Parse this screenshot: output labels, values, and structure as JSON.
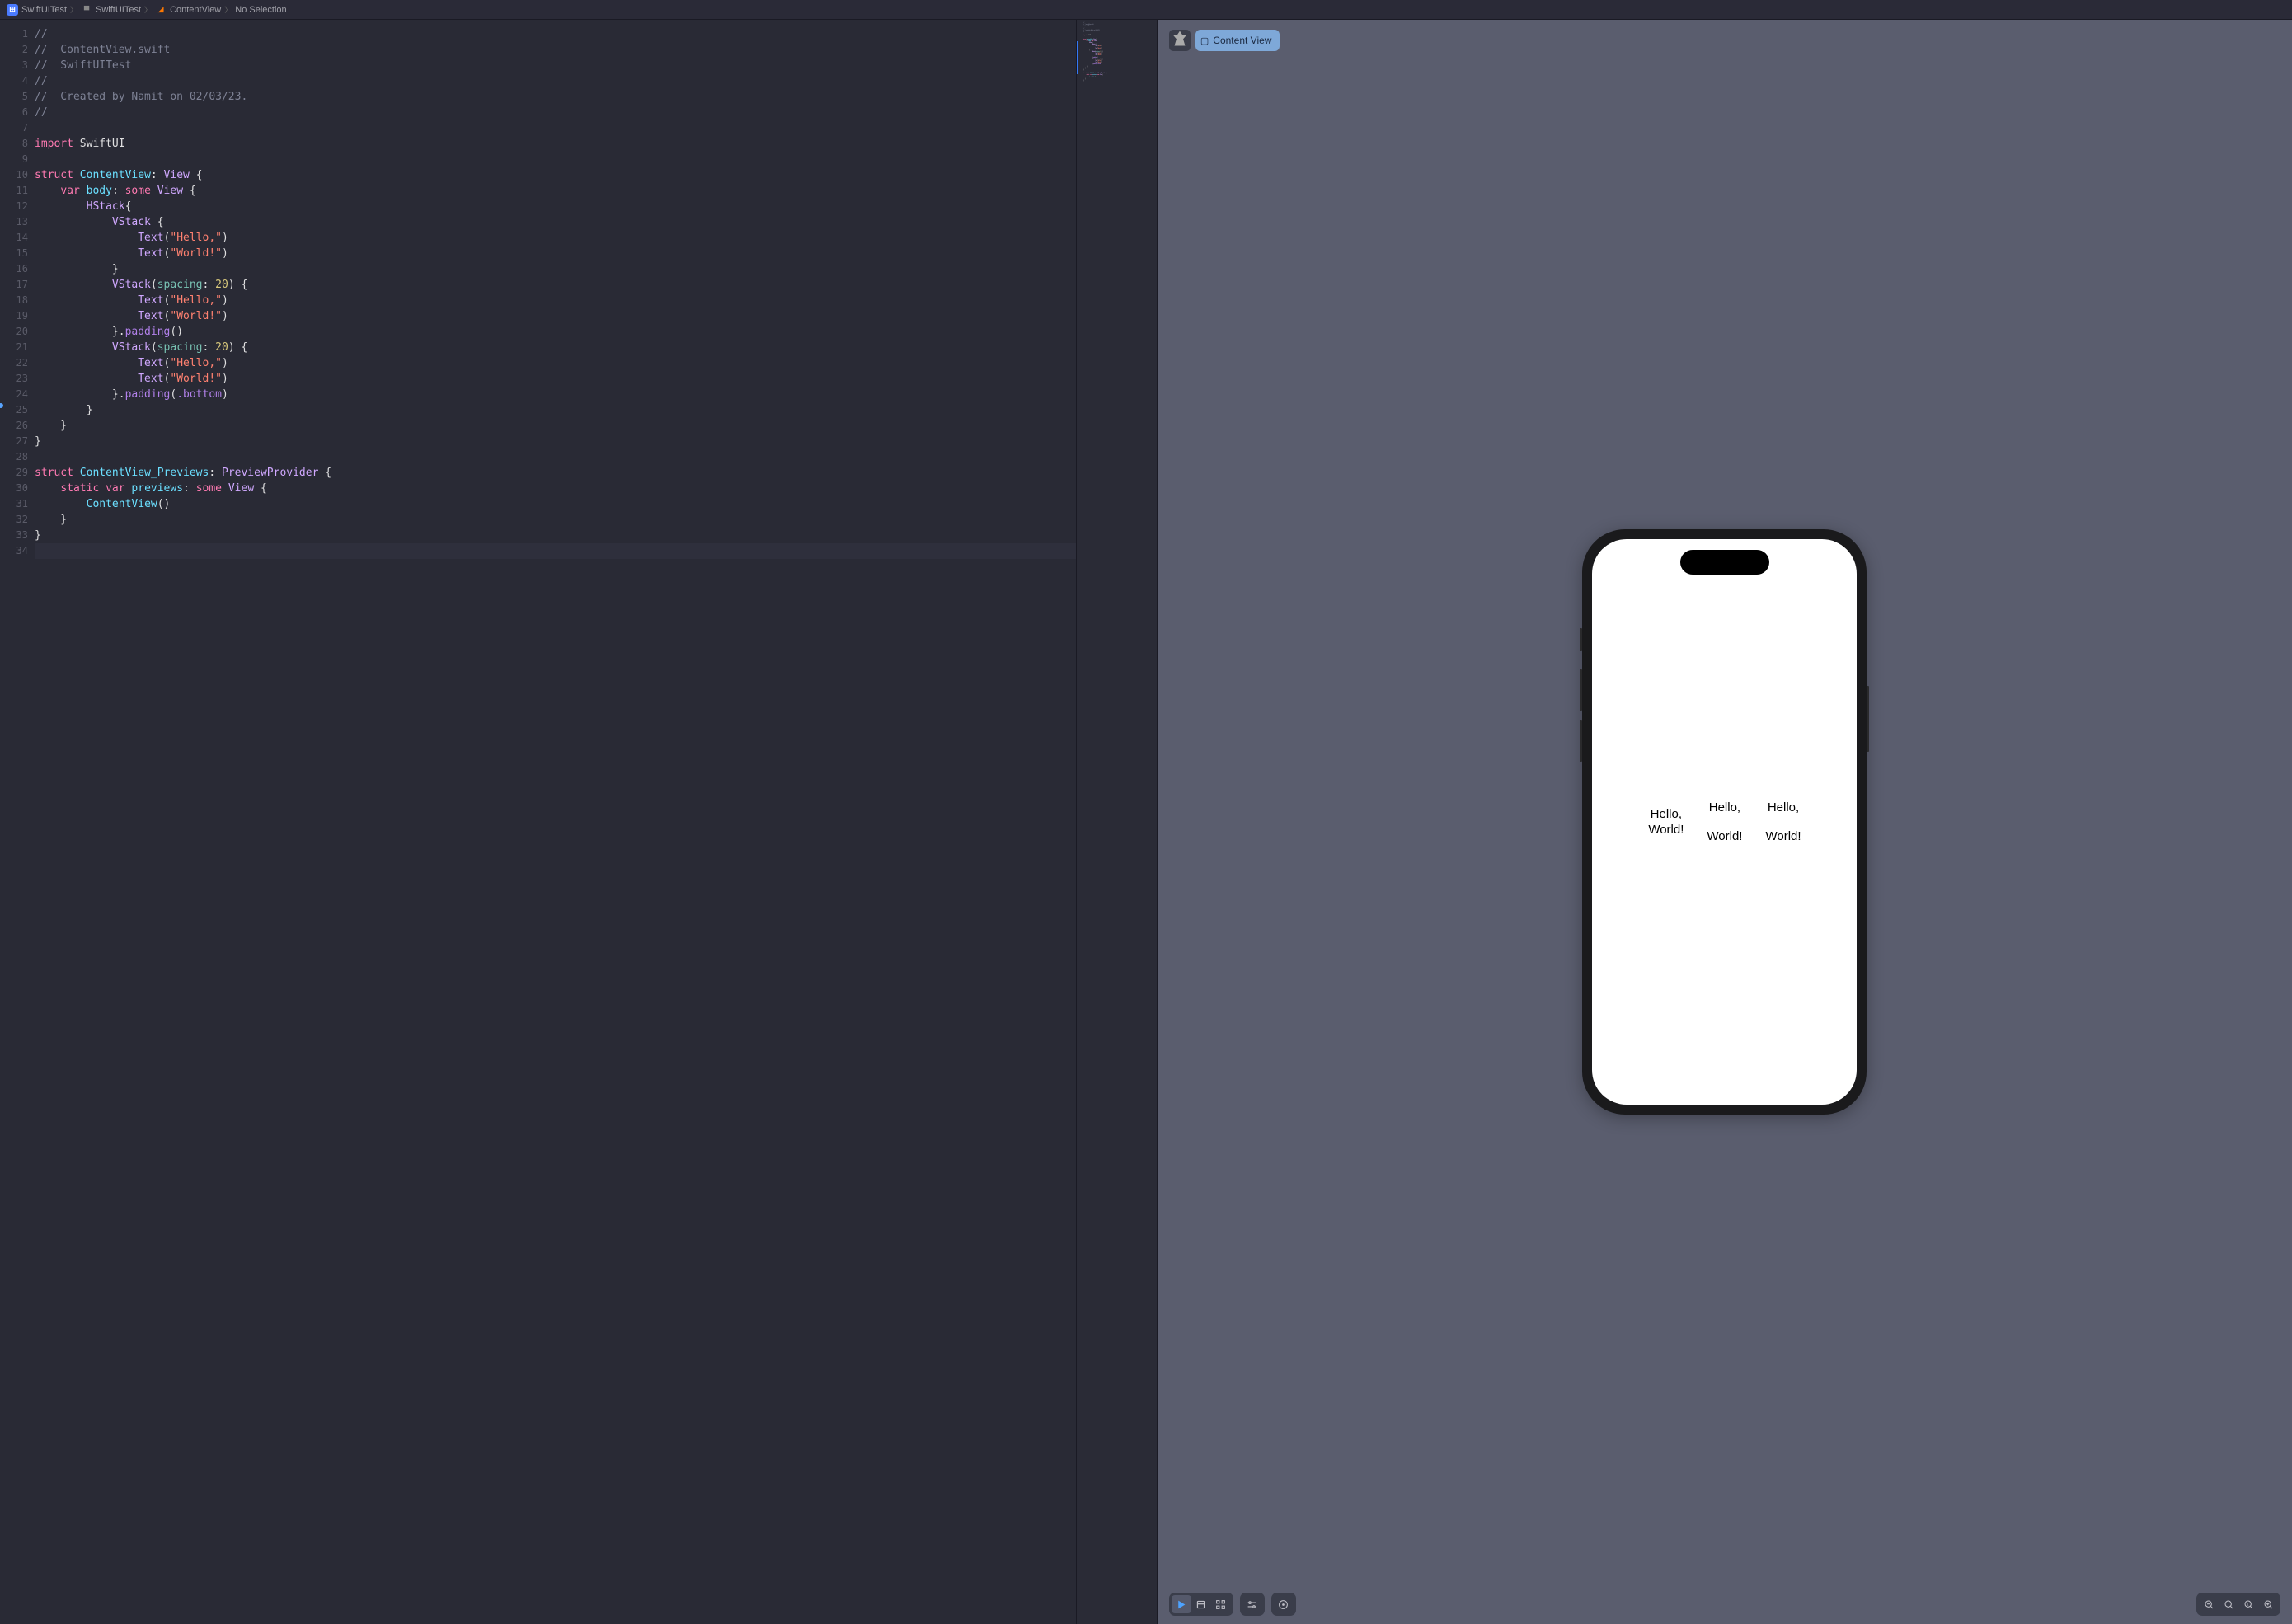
{
  "breadcrumb": {
    "project": "SwiftUITest",
    "folder": "SwiftUITest",
    "file": "ContentView",
    "selection": "No Selection"
  },
  "code": {
    "lines": [
      {
        "n": 1,
        "t": "comment",
        "txt": "//"
      },
      {
        "n": 2,
        "t": "comment",
        "txt": "//  ContentView.swift"
      },
      {
        "n": 3,
        "t": "comment",
        "txt": "//  SwiftUITest"
      },
      {
        "n": 4,
        "t": "comment",
        "txt": "//"
      },
      {
        "n": 5,
        "t": "comment",
        "txt": "//  Created by Namit on 02/03/23."
      },
      {
        "n": 6,
        "t": "comment",
        "txt": "//"
      },
      {
        "n": 7,
        "t": "blank",
        "txt": ""
      },
      {
        "n": 8,
        "t": "import",
        "kw": "import",
        "mod": "SwiftUI"
      },
      {
        "n": 9,
        "t": "blank",
        "txt": ""
      },
      {
        "n": 10,
        "t": "struct1",
        "kw": "struct",
        "name": "ContentView",
        "proto": "View"
      },
      {
        "n": 11,
        "t": "body",
        "kw": "var",
        "name": "body",
        "some": "some",
        "type": "View"
      },
      {
        "n": 12,
        "t": "hstack",
        "txt": "        HStack{"
      },
      {
        "n": 13,
        "t": "vstack",
        "txt": "            VStack {"
      },
      {
        "n": 14,
        "t": "text",
        "indent": "                ",
        "fn": "Text",
        "str": "\"Hello,\""
      },
      {
        "n": 15,
        "t": "text",
        "indent": "                ",
        "fn": "Text",
        "str": "\"World!\""
      },
      {
        "n": 16,
        "t": "plain",
        "txt": "            }"
      },
      {
        "n": 17,
        "t": "vstackp",
        "indent": "            ",
        "name": "VStack",
        "param": "spacing",
        "val": "20"
      },
      {
        "n": 18,
        "t": "text",
        "indent": "                ",
        "fn": "Text",
        "str": "\"Hello,\""
      },
      {
        "n": 19,
        "t": "text",
        "indent": "                ",
        "fn": "Text",
        "str": "\"World!\""
      },
      {
        "n": 20,
        "t": "pad",
        "indent": "            ",
        "txt": "}.",
        "fn": "padding",
        "args": "()"
      },
      {
        "n": 21,
        "t": "vstackp",
        "indent": "            ",
        "name": "VStack",
        "param": "spacing",
        "val": "20"
      },
      {
        "n": 22,
        "t": "text",
        "indent": "                ",
        "fn": "Text",
        "str": "\"Hello,\""
      },
      {
        "n": 23,
        "t": "text",
        "indent": "                ",
        "fn": "Text",
        "str": "\"World!\""
      },
      {
        "n": 24,
        "t": "pad2",
        "indent": "            ",
        "txt": "}.",
        "fn": "padding",
        "arg": ".bottom"
      },
      {
        "n": 25,
        "t": "plain",
        "txt": "        }"
      },
      {
        "n": 26,
        "t": "plain",
        "txt": "    }"
      },
      {
        "n": 27,
        "t": "plain",
        "txt": "}"
      },
      {
        "n": 28,
        "t": "blank",
        "txt": ""
      },
      {
        "n": 29,
        "t": "struct2",
        "kw": "struct",
        "name": "ContentView_Previews",
        "proto": "PreviewProvider"
      },
      {
        "n": 30,
        "t": "previews",
        "kw1": "static",
        "kw2": "var",
        "name": "previews",
        "some": "some",
        "type": "View"
      },
      {
        "n": 31,
        "t": "call",
        "indent": "        ",
        "fn": "ContentView",
        "args": "()"
      },
      {
        "n": 32,
        "t": "plain",
        "txt": "    }"
      },
      {
        "n": 33,
        "t": "plain",
        "txt": "}"
      },
      {
        "n": 34,
        "t": "cursor",
        "txt": ""
      }
    ]
  },
  "preview": {
    "pill_label": "Content View",
    "stacks": [
      {
        "hello": "Hello,",
        "world": "World!"
      },
      {
        "hello": "Hello,",
        "world": "World!"
      },
      {
        "hello": "Hello,",
        "world": "World!"
      }
    ]
  }
}
